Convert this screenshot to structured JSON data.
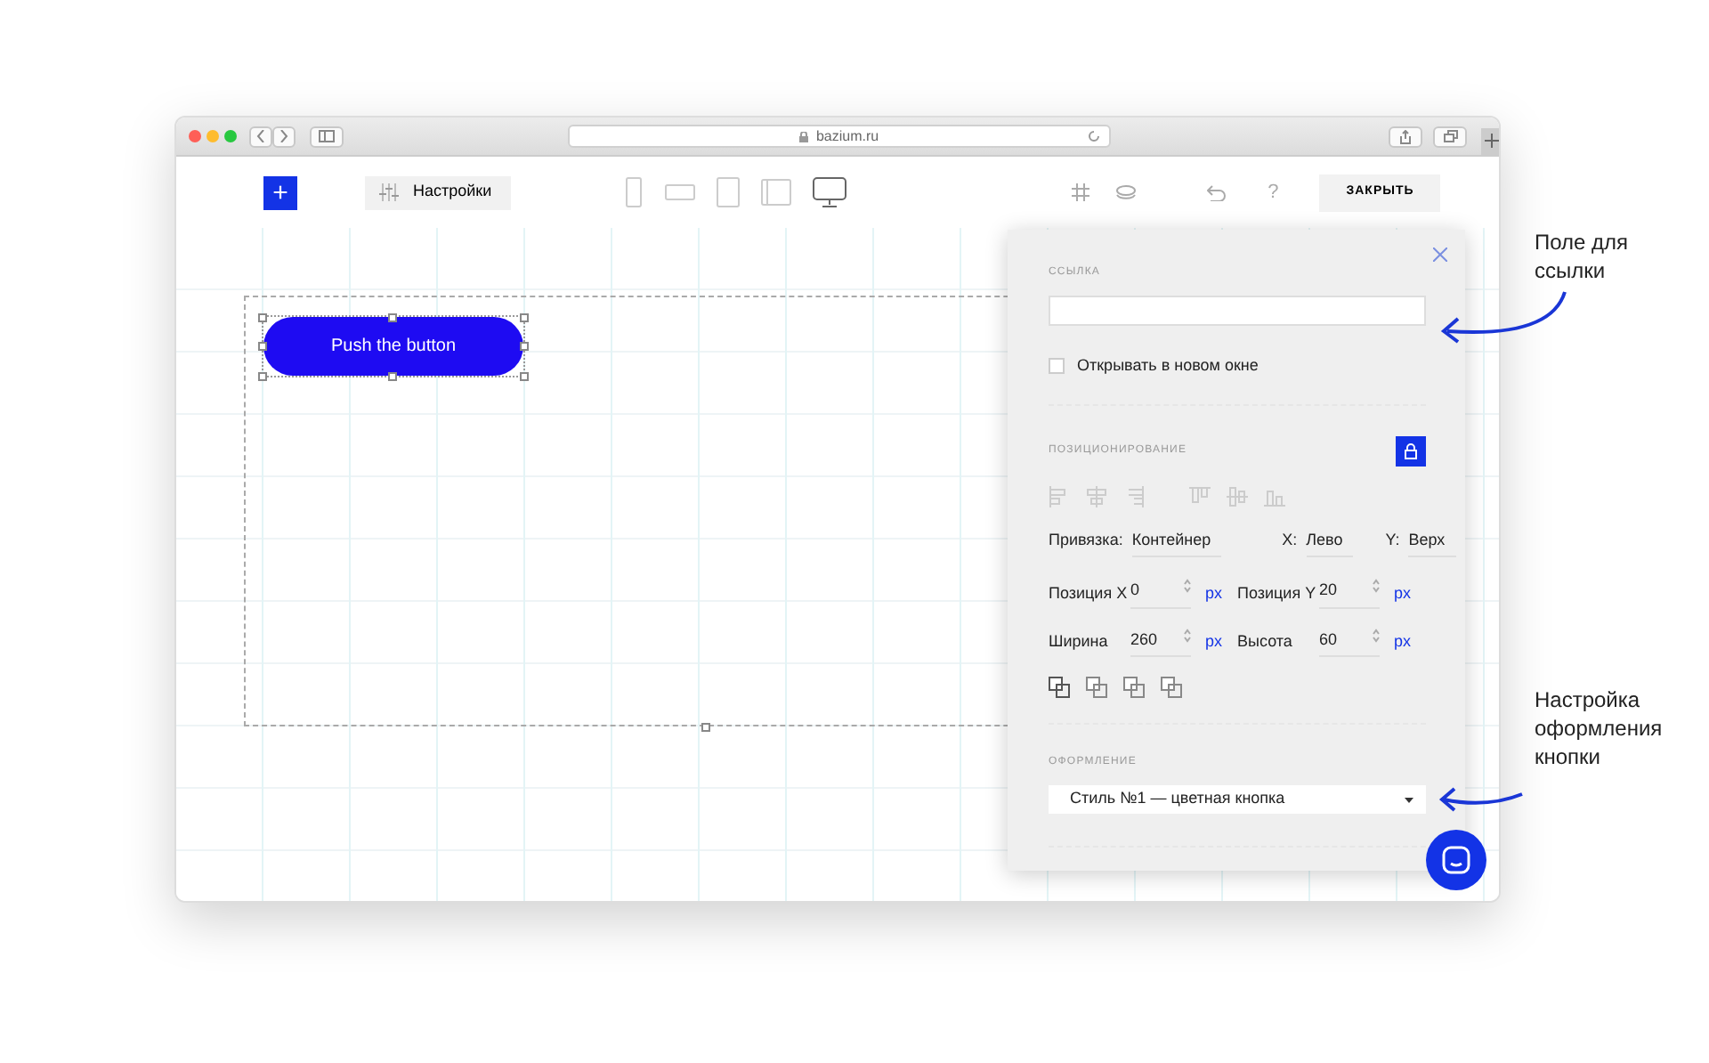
{
  "browser": {
    "url": "bazium.ru"
  },
  "toolbar": {
    "add_button": "+",
    "settings_button": "Настройки",
    "devices": [
      {
        "kind": "phone",
        "selected": false
      },
      {
        "kind": "phone-landscape",
        "selected": false
      },
      {
        "kind": "tablet",
        "selected": false
      },
      {
        "kind": "tablet-landscape",
        "selected": false
      },
      {
        "kind": "desktop",
        "selected": true
      }
    ],
    "help": "?",
    "close_button": "ЗАКРЫТЬ"
  },
  "canvas": {
    "element_label": "Push the button"
  },
  "panel": {
    "link_section": {
      "title": "ССЫЛКА",
      "checkbox": {
        "label": "Открывать в новом окне",
        "checked": false
      }
    },
    "positioning": {
      "title": "ПОЗИЦИОНИРОВАНИЕ",
      "locked": true,
      "anchor": [
        {
          "label": "Привязка:",
          "value": "Контейнер"
        },
        {
          "label": "X:",
          "value": "Лево"
        },
        {
          "label": "Y:",
          "value": "Верх"
        }
      ],
      "fields": [
        {
          "label": "Позиция X",
          "value": "0",
          "unit": "px"
        },
        {
          "label": "Позиция Y",
          "value": "20",
          "unit": "px"
        },
        {
          "label": "Ширина",
          "value": "260",
          "unit": "px"
        },
        {
          "label": "Высота",
          "value": "60",
          "unit": "px"
        }
      ]
    },
    "style_section": {
      "title": "ОФОРМЛЕНИЕ",
      "select": "Стиль №1 — цветная кнопка"
    }
  },
  "annotations": [
    {
      "lines": [
        "Поле для",
        "ссылки"
      ]
    },
    {
      "lines": [
        "Настройка",
        "оформления",
        "кнопки"
      ]
    }
  ]
}
